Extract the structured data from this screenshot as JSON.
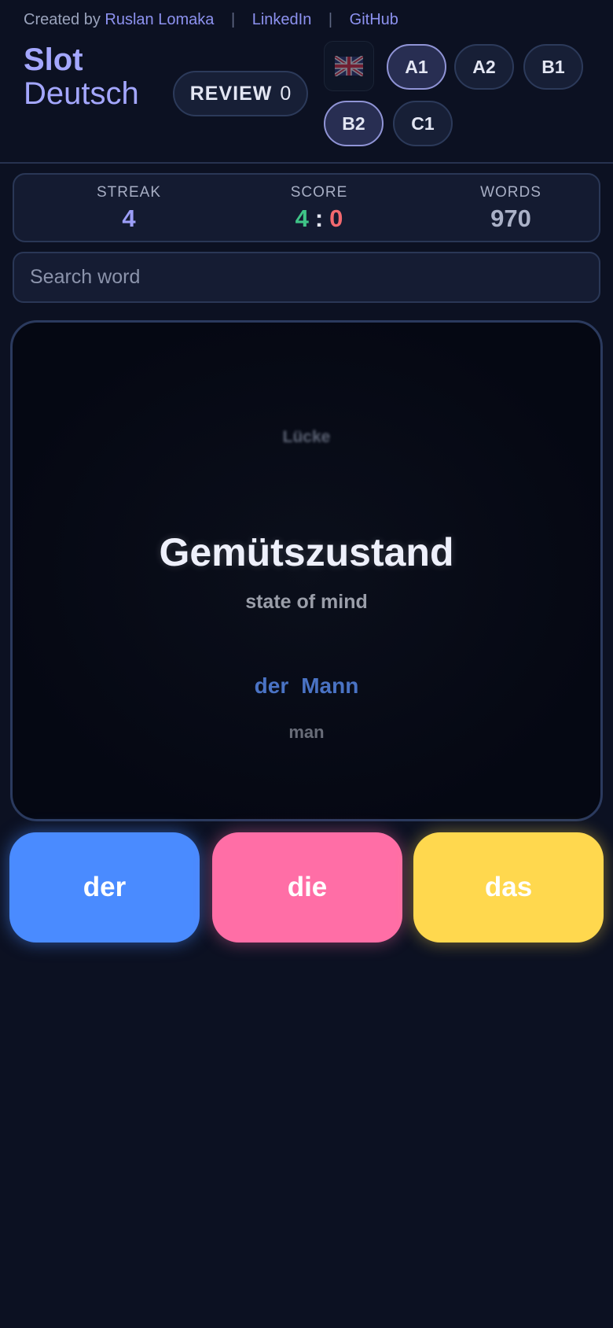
{
  "credits": {
    "prefix": "Created by",
    "author": "Ruslan Lomaka",
    "separator": "|",
    "linkedin": "LinkedIn",
    "github": "GitHub"
  },
  "logo": {
    "line1": "Slot",
    "line2": "Deutsch"
  },
  "review": {
    "label": "REVIEW",
    "count": "0"
  },
  "language_flag": "uk-flag-icon",
  "levels": [
    {
      "label": "A1",
      "active": true
    },
    {
      "label": "A2",
      "active": false
    },
    {
      "label": "B1",
      "active": false
    },
    {
      "label": "B2",
      "active": true
    },
    {
      "label": "C1",
      "active": false
    }
  ],
  "stats": {
    "streak": {
      "label": "STREAK",
      "value": "4"
    },
    "score": {
      "label": "SCORE",
      "correct": "4",
      "separator": ":",
      "wrong": "0"
    },
    "words": {
      "label": "WORDS",
      "value": "970"
    }
  },
  "search": {
    "placeholder": "Search word",
    "value": ""
  },
  "card": {
    "previous_word": "Lücke",
    "current_word": "Gemütszustand",
    "current_translation": "state of mind",
    "next_article": "der",
    "next_word": "Mann",
    "next_translation": "man"
  },
  "articles": [
    {
      "label": "der",
      "color": "#4a8bff"
    },
    {
      "label": "die",
      "color": "#ff6ea6"
    },
    {
      "label": "das",
      "color": "#ffd84e"
    }
  ],
  "colors": {
    "background": "#0c1122",
    "accent": "#a4a7ff",
    "correct": "#3fc487",
    "wrong": "#f2696f"
  }
}
